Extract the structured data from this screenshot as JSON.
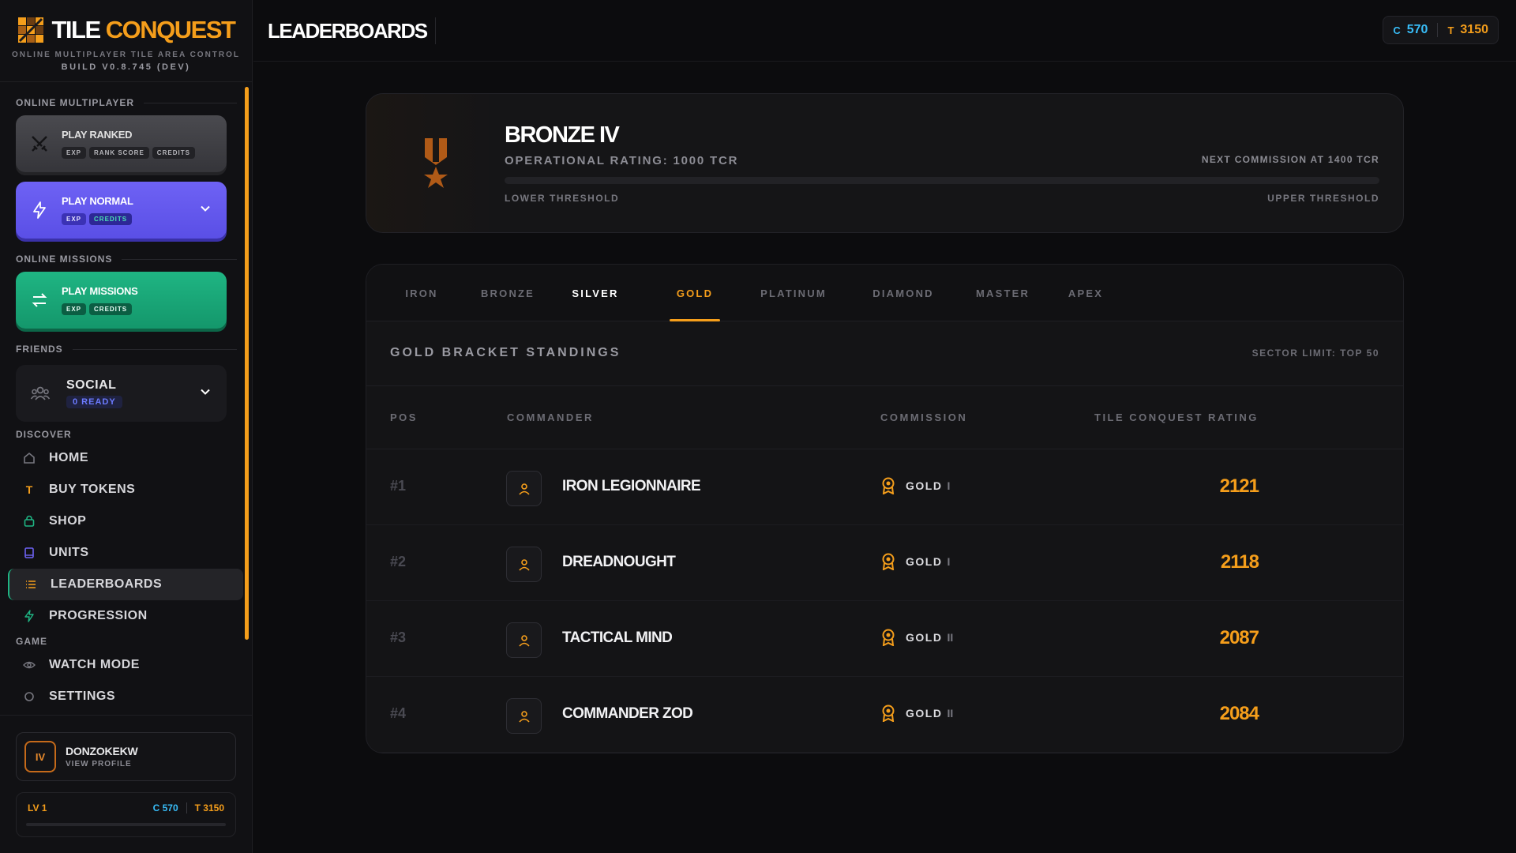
{
  "brand": {
    "title_white": "TILE",
    "title_orange": "CONQUEST",
    "subtitle": "ONLINE MULTIPLAYER TILE AREA CONTROL",
    "build": "BUILD V0.8.745 (DEV)"
  },
  "sidebar": {
    "online_multiplayer_label": "ONLINE MULTIPLAYER",
    "play_ranked": {
      "title": "PLAY RANKED",
      "tags": [
        "EXP",
        "RANK SCORE",
        "CREDITS"
      ]
    },
    "play_normal": {
      "title": "PLAY NORMAL",
      "tags": [
        "EXP",
        "CREDITS"
      ]
    },
    "online_missions_label": "ONLINE MISSIONS",
    "play_missions": {
      "title": "PLAY MISSIONS",
      "tags": [
        "EXP",
        "CREDITS"
      ]
    },
    "friends_label": "FRIENDS",
    "social": {
      "title": "SOCIAL",
      "status": "0 READY"
    },
    "discover_label": "DISCOVER",
    "nav": [
      {
        "label": "HOME",
        "icon": "home-icon"
      },
      {
        "label": "BUY TOKENS",
        "icon": "token-icon"
      },
      {
        "label": "SHOP",
        "icon": "bag-icon"
      },
      {
        "label": "UNITS",
        "icon": "book-icon"
      },
      {
        "label": "LEADERBOARDS",
        "icon": "list-icon"
      },
      {
        "label": "PROGRESSION",
        "icon": "bolt-icon"
      }
    ],
    "game_label": "GAME",
    "game_nav": [
      {
        "label": "WATCH MODE",
        "icon": "eye-icon"
      },
      {
        "label": "SETTINGS",
        "icon": "gear-icon"
      }
    ]
  },
  "profile": {
    "avatar": "IV",
    "name": "DONZOKEKW",
    "view": "VIEW PROFILE",
    "level": "LV 1",
    "credits": "C 570",
    "tokens": "T 3150",
    "level_progress": 0
  },
  "header": {
    "title": "LEADERBOARDS",
    "credits_prefix": "C",
    "credits": "570",
    "tokens_prefix": "T",
    "tokens": "3150"
  },
  "rank": {
    "name": "BRONZE IV",
    "rating": "OPERATIONAL RATING: 1000 TCR",
    "next": "NEXT COMMISSION AT 1400 TCR",
    "lower": "LOWER THRESHOLD",
    "upper": "UPPER THRESHOLD",
    "progress": 0
  },
  "tabs": [
    "IRON",
    "BRONZE",
    "SILVER",
    "GOLD",
    "PLATINUM",
    "DIAMOND",
    "MASTER",
    "APEX"
  ],
  "active_tab": "GOLD",
  "board": {
    "title": "GOLD BRACKET STANDINGS",
    "limit": "SECTOR LIMIT: TOP 50",
    "columns": {
      "pos": "POS",
      "commander": "COMMANDER",
      "commission": "COMMISSION",
      "rating": "TILE CONQUEST RATING"
    },
    "rows": [
      {
        "pos": "#1",
        "commander": "IRON LEGIONNAIRE",
        "league": "GOLD",
        "tier": "I",
        "rating": "2121"
      },
      {
        "pos": "#2",
        "commander": "DREADNOUGHT",
        "league": "GOLD",
        "tier": "I",
        "rating": "2118"
      },
      {
        "pos": "#3",
        "commander": "TACTICAL MIND",
        "league": "GOLD",
        "tier": "II",
        "rating": "2087"
      },
      {
        "pos": "#4",
        "commander": "COMMANDER ZOD",
        "league": "GOLD",
        "tier": "II",
        "rating": "2084"
      }
    ]
  },
  "colors": {
    "accent": "#f59e1b",
    "credits": "#38bdf8",
    "normal": "#6e62f4",
    "missions": "#1fb583"
  }
}
